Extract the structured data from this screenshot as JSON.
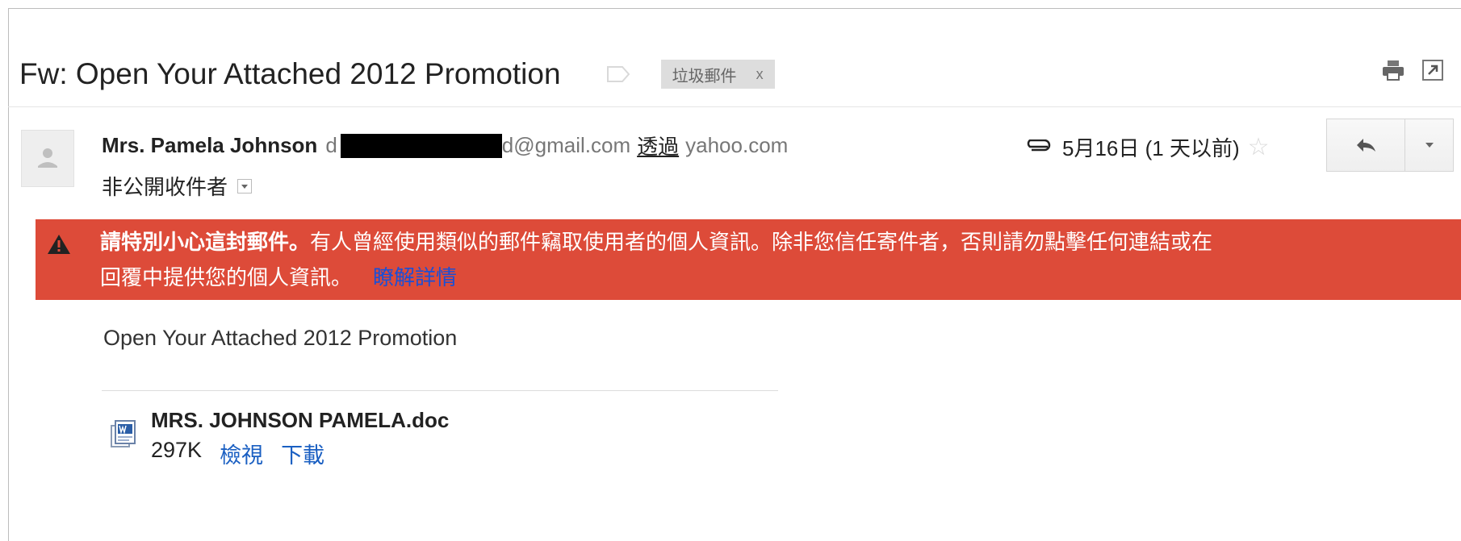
{
  "message": {
    "subject": "Fw: Open Your Attached 2012 Promotion",
    "label": {
      "text": "垃圾郵件",
      "remove": "x"
    },
    "sender": {
      "name": "Mrs. Pamela Johnson",
      "email_prefix": "d",
      "email_suffix": "d@gmail.com",
      "via_label": "透過",
      "via_domain": "yahoo.com"
    },
    "recipients": "非公開收件者",
    "date": "5月16日 (1 天以前)",
    "warning": {
      "bold": "請特別小心這封郵件。",
      "line1_rest": "有人曾經使用類似的郵件竊取使用者的個人資訊。除非您信任寄件者，否則請勿點擊任何連結或在",
      "line2": "回覆中提供您的個人資訊。",
      "link": "瞭解詳情"
    },
    "body": "Open Your Attached 2012 Promotion",
    "attachment": {
      "filename": "MRS. JOHNSON PAMELA.doc",
      "size": "297K",
      "view": "檢視",
      "download": "下載"
    }
  },
  "colors": {
    "warning_bg": "#dd4b39",
    "link": "#1a5fc2",
    "label_bg": "#dddddd"
  },
  "icons": [
    "tag-icon",
    "print-icon",
    "new-window-icon",
    "avatar-icon",
    "paperclip-icon",
    "star-icon",
    "reply-icon",
    "dropdown-icon",
    "warning-icon",
    "word-doc-icon"
  ]
}
